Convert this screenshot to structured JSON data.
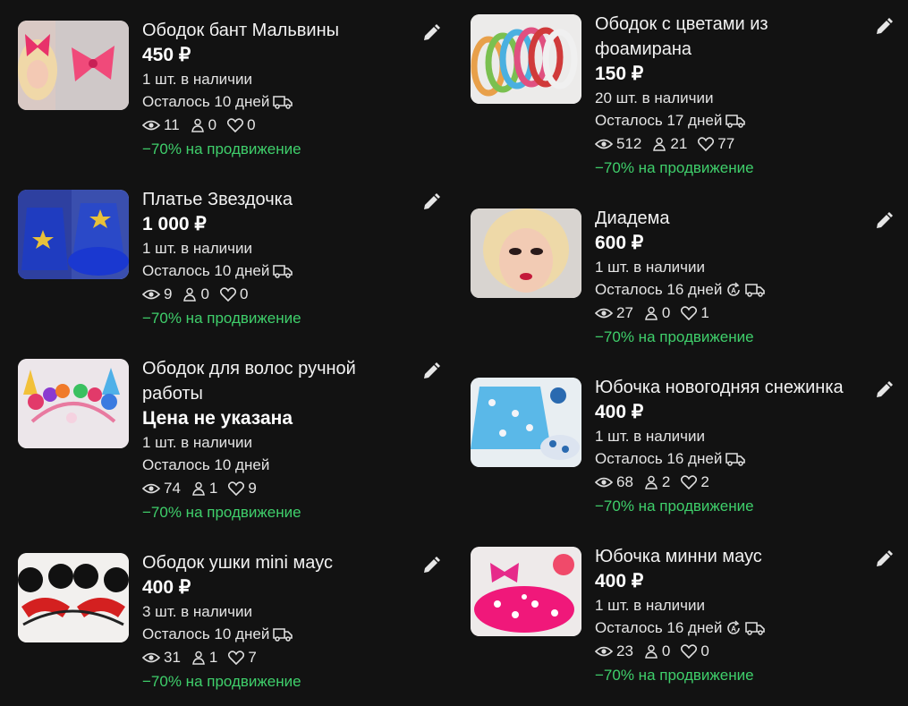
{
  "items": [
    {
      "title": "Ободок бант Мальвины",
      "price": "450 ₽",
      "stock": "1 шт. в наличии",
      "remaining": "Осталось 10 дней",
      "views": "11",
      "contacts": "0",
      "likes": "0",
      "promo": "−70% на продвижение",
      "delivery": true,
      "auto": false
    },
    {
      "title": "Платье Звездочка",
      "price": "1 000 ₽",
      "stock": "1 шт. в наличии",
      "remaining": "Осталось 10 дней",
      "views": "9",
      "contacts": "0",
      "likes": "0",
      "promo": "−70% на продвижение",
      "delivery": true,
      "auto": false
    },
    {
      "title": "Ободок для волос ручной работы",
      "price": "Цена не указана",
      "stock": "1 шт. в наличии",
      "remaining": "Осталось 10 дней",
      "views": "74",
      "contacts": "1",
      "likes": "9",
      "promo": "−70% на продвижение",
      "delivery": false,
      "auto": false
    },
    {
      "title": "Ободок ушки mini маус",
      "price": "400 ₽",
      "stock": "3 шт. в наличии",
      "remaining": "Осталось 10 дней",
      "views": "31",
      "contacts": "1",
      "likes": "7",
      "promo": "−70% на продвижение",
      "delivery": true,
      "auto": false
    },
    {
      "title": "Ободок с цветами из фоамирана",
      "price": "150 ₽",
      "stock": "20 шт. в наличии",
      "remaining": "Осталось 17 дней",
      "views": "512",
      "contacts": "21",
      "likes": "77",
      "promo": "−70% на продвижение",
      "delivery": true,
      "auto": false
    },
    {
      "title": "Диадема",
      "price": "600 ₽",
      "stock": "1 шт. в наличии",
      "remaining": "Осталось 16 дней",
      "views": "27",
      "contacts": "0",
      "likes": "1",
      "promo": "−70% на продвижение",
      "delivery": true,
      "auto": true
    },
    {
      "title": "Юбочка новогодняя снежинка",
      "price": "400 ₽",
      "stock": "1 шт. в наличии",
      "remaining": "Осталось 16 дней",
      "views": "68",
      "contacts": "2",
      "likes": "2",
      "promo": "−70% на продвижение",
      "delivery": true,
      "auto": false
    },
    {
      "title": "Юбочка минни маус",
      "price": "400 ₽",
      "stock": "1 шт. в наличии",
      "remaining": "Осталось 16 дней",
      "views": "23",
      "contacts": "0",
      "likes": "0",
      "promo": "−70% на продвижение",
      "delivery": true,
      "auto": true
    }
  ],
  "colors": {
    "background": "#121212",
    "promo": "#3fcf6b",
    "text": "#ffffff"
  },
  "icons": {
    "views": "eye-icon",
    "contacts": "person-icon",
    "likes": "heart-icon",
    "edit": "pencil-icon",
    "delivery": "truck-icon",
    "auto": "auto-renew-icon"
  }
}
